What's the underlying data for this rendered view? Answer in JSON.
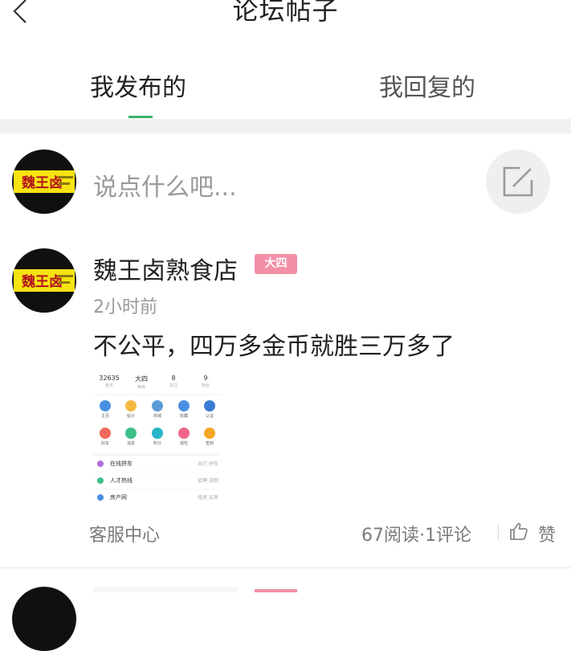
{
  "header": {
    "title": "论坛帖子",
    "back_icon": "chevron-left-icon"
  },
  "tabs": [
    {
      "label": "我发布的",
      "active": true
    },
    {
      "label": "我回复的",
      "active": false
    }
  ],
  "accent_color": "#3cb371",
  "compose": {
    "placeholder": "说点什么吧...",
    "icon": "edit-icon"
  },
  "post": {
    "author": "魏王卤熟食店",
    "avatar_text": "魏王卤",
    "badge": "大四",
    "badge_color": "#f390a8",
    "time": "2小时前",
    "content": "不公平，四万多金币就胜三万多了",
    "thumbnail": {
      "stats": [
        {
          "value": "32635",
          "label": "金币"
        },
        {
          "value": "大四",
          "label": "等级"
        },
        {
          "value": "8",
          "label": "关注"
        },
        {
          "value": "9",
          "label": "粉丝"
        }
      ],
      "grid": [
        "主页",
        "帖子",
        "商城",
        "收藏",
        "认证",
        "好友",
        "消息",
        "积分",
        "钱包",
        "签到"
      ],
      "rows": [
        {
          "label": "在线拼车",
          "right": "出行 拼车"
        },
        {
          "label": "人才热线",
          "right": "招聘 求职"
        },
        {
          "label": "房产网",
          "right": "租房 买房"
        }
      ]
    },
    "footer": {
      "channel": "客服中心",
      "views": "67阅读",
      "comments": "1评论",
      "like_label": "赞",
      "like_icon": "thumbs-up-icon"
    }
  }
}
